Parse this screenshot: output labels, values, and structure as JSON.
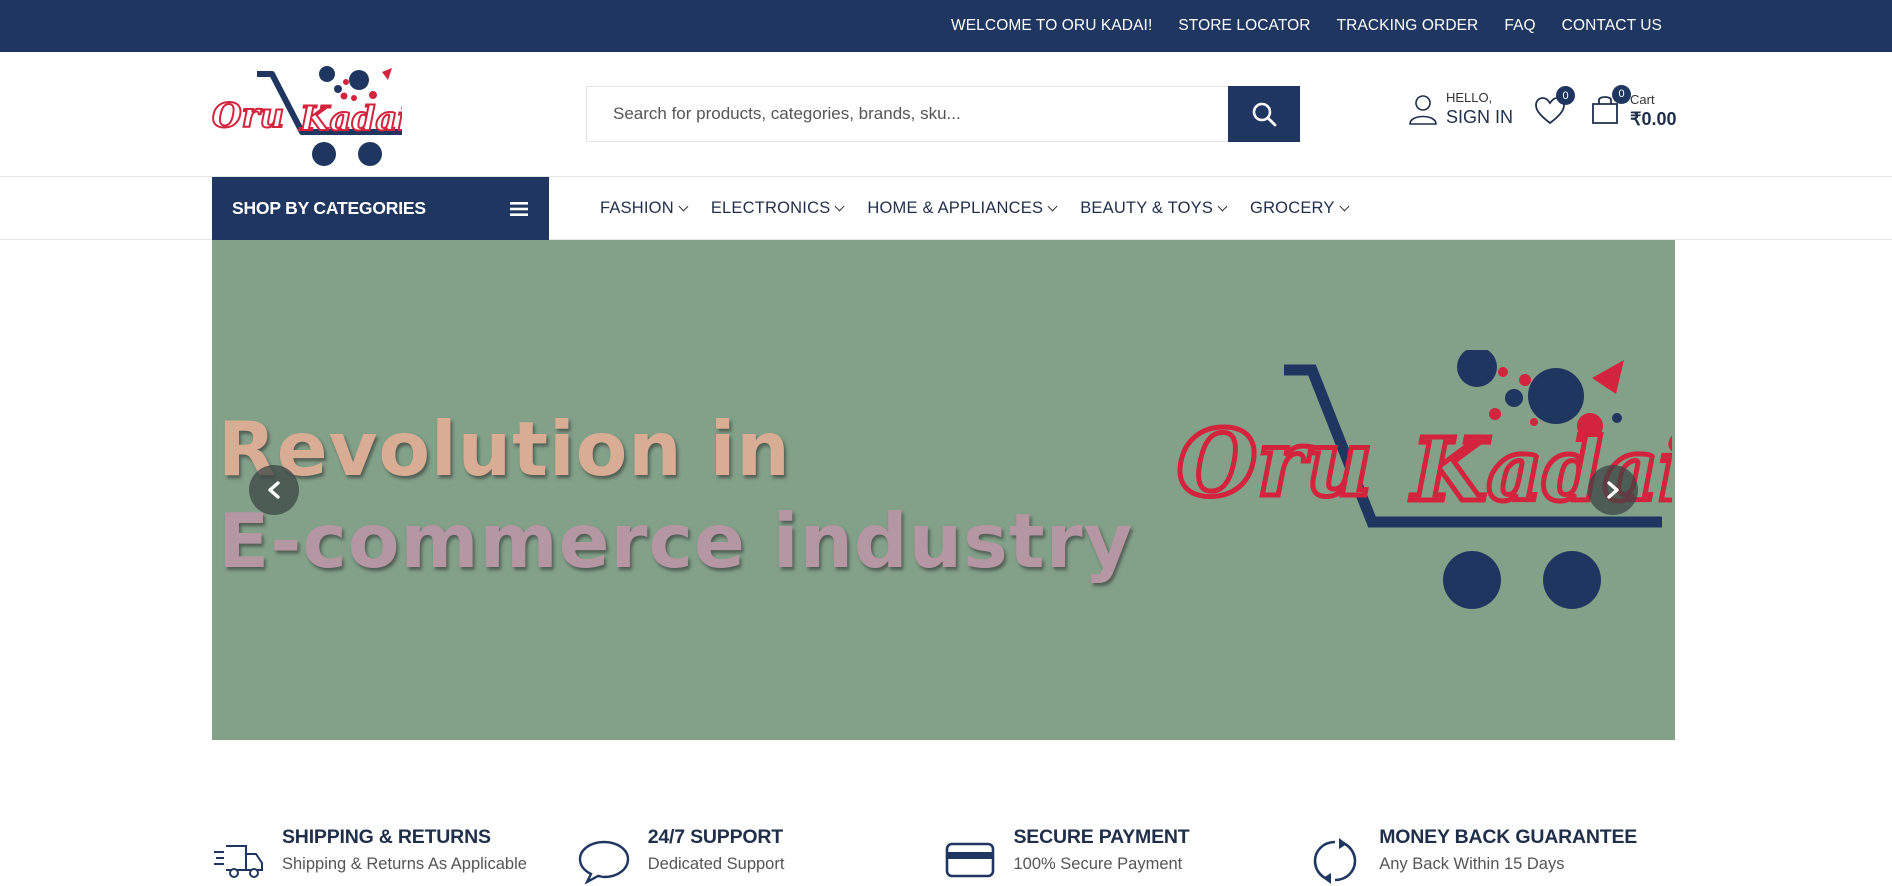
{
  "topbar": {
    "links": [
      "WELCOME TO ORU KADAI!",
      "STORE LOCATOR",
      "TRACKING ORDER",
      "FAQ",
      "CONTACT US"
    ]
  },
  "brand": {
    "logo_text": "Oru Kadai"
  },
  "search": {
    "placeholder": "Search for products, categories, brands, sku..."
  },
  "account": {
    "greeting": "HELLO,",
    "action": "SIGN IN"
  },
  "wishlist": {
    "count": "0"
  },
  "cart": {
    "label": "Cart",
    "total": "₹0.00",
    "count": "0"
  },
  "nav": {
    "categories_label": "SHOP BY CATEGORIES",
    "menu": [
      "FASHION",
      "ELECTRONICS",
      "HOME & APPLIANCES",
      "BEAUTY & TOYS",
      "GROCERY"
    ]
  },
  "banner": {
    "line1": "Revolution in",
    "line2": "E-commerce industry",
    "logo_text": "Oru Kadai",
    "background": "#83a089"
  },
  "features": [
    {
      "title": "SHIPPING & RETURNS",
      "subtitle": "Shipping & Returns As Applicable",
      "icon": "truck-icon"
    },
    {
      "title": "24/7 SUPPORT",
      "subtitle": "Dedicated Support",
      "icon": "chat-icon"
    },
    {
      "title": "SECURE PAYMENT",
      "subtitle": "100% Secure Payment",
      "icon": "credit-card-icon"
    },
    {
      "title": "MONEY BACK GUARANTEE",
      "subtitle": "Any Back Within 15 Days",
      "icon": "refresh-icon"
    }
  ],
  "colors": {
    "primary": "#1f3760",
    "accent": "#d4233c",
    "banner_bg": "#83a089"
  }
}
